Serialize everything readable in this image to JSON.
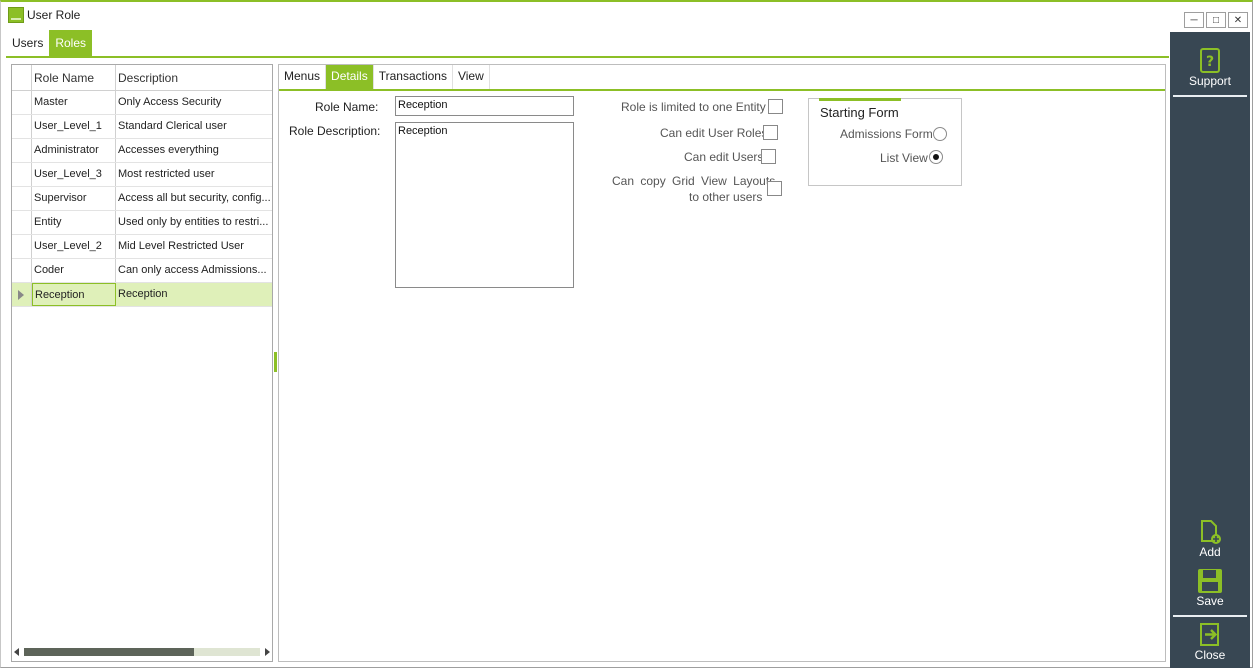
{
  "window": {
    "title": "User Role"
  },
  "top_tabs": [
    {
      "label": "Users",
      "active": false
    },
    {
      "label": "Roles",
      "active": true
    }
  ],
  "grid": {
    "columns": [
      "Role Name",
      "Description"
    ],
    "rows": [
      {
        "name": "Master",
        "description": "Only Access Security"
      },
      {
        "name": "User_Level_1",
        "description": "Standard Clerical user"
      },
      {
        "name": "Administrator",
        "description": "Accesses everything"
      },
      {
        "name": "User_Level_3",
        "description": "Most restricted user"
      },
      {
        "name": "Supervisor",
        "description": "Access all but security, config..."
      },
      {
        "name": "Entity",
        "description": "Used only by entities to restri..."
      },
      {
        "name": "User_Level_2",
        "description": "Mid Level Restricted User"
      },
      {
        "name": "Coder",
        "description": "Can only access Admissions..."
      },
      {
        "name": "Reception",
        "description": "Reception",
        "selected": true
      }
    ]
  },
  "sub_tabs": [
    {
      "label": "Menus",
      "active": false
    },
    {
      "label": "Details",
      "active": true
    },
    {
      "label": "Transactions",
      "active": false
    },
    {
      "label": "View",
      "active": false
    }
  ],
  "details": {
    "role_name_label": "Role Name:",
    "role_name_value": "Reception",
    "role_desc_label": "Role Description:",
    "role_desc_value": "Reception",
    "checkboxes": [
      {
        "label": "Role is limited to one Entity",
        "checked": false
      },
      {
        "label": "Can edit User Roles",
        "checked": false
      },
      {
        "label": "Can edit Users",
        "checked": false
      },
      {
        "label_line1": "Can copy Grid View Layouts",
        "label_line2": "to other users",
        "checked": false
      }
    ],
    "starting_form": {
      "title": "Starting Form",
      "options": [
        {
          "label": "Admissions Form",
          "selected": false
        },
        {
          "label": "List View",
          "selected": true
        }
      ]
    }
  },
  "side_panel": {
    "support": "Support",
    "add": "Add",
    "save": "Save",
    "close": "Close"
  },
  "colors": {
    "accent": "#8cbf26",
    "side_bg": "#384753",
    "selected_row": "#dff0b9"
  }
}
